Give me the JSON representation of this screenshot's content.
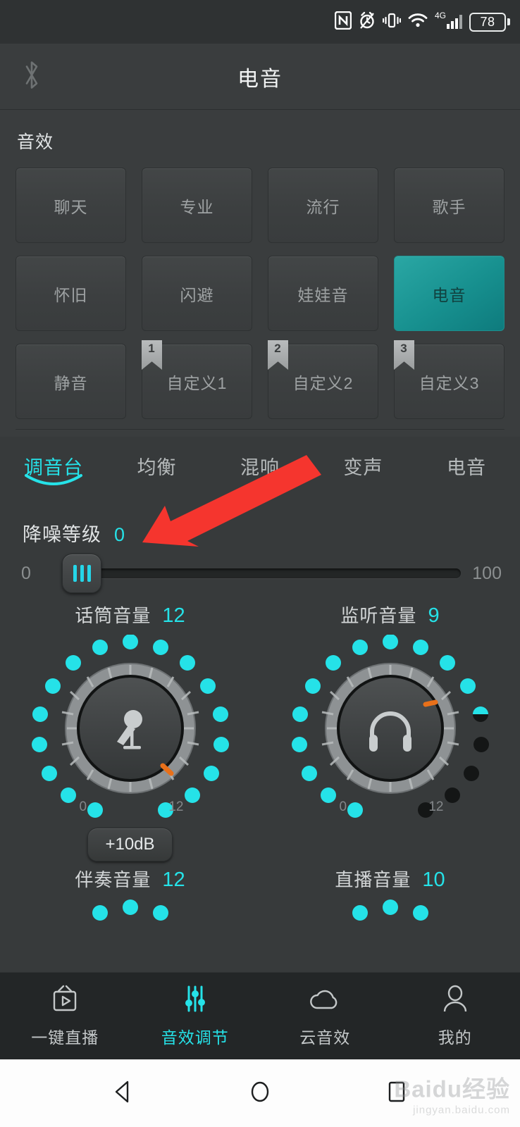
{
  "colors": {
    "accent_cyan": "#25e2e8",
    "selected_teal": "#17908f",
    "arrow_red": "#f5352e",
    "panel_bg": "#3a3d3e",
    "page_bg": "#373a3b",
    "nav_bg": "#232627",
    "indicator_orange": "#e8701a"
  },
  "status_bar": {
    "icons": [
      "nfc-icon",
      "alarm-icon",
      "vibrate-icon",
      "wifi-icon",
      "signal-4g-icon",
      "battery-icon"
    ],
    "network_label": "4G",
    "battery_level": "78"
  },
  "header": {
    "title": "电音",
    "left_icon": "bluetooth-icon"
  },
  "effects": {
    "section_title": "音效",
    "presets": [
      {
        "label": "聊天",
        "selected": false,
        "tag": ""
      },
      {
        "label": "专业",
        "selected": false,
        "tag": ""
      },
      {
        "label": "流行",
        "selected": false,
        "tag": ""
      },
      {
        "label": "歌手",
        "selected": false,
        "tag": ""
      },
      {
        "label": "怀旧",
        "selected": false,
        "tag": ""
      },
      {
        "label": "闪避",
        "selected": false,
        "tag": ""
      },
      {
        "label": "娃娃音",
        "selected": false,
        "tag": ""
      },
      {
        "label": "电音",
        "selected": true,
        "tag": ""
      },
      {
        "label": "静音",
        "selected": false,
        "tag": ""
      },
      {
        "label": "自定义1",
        "selected": false,
        "tag": "1"
      },
      {
        "label": "自定义2",
        "selected": false,
        "tag": "2"
      },
      {
        "label": "自定义3",
        "selected": false,
        "tag": "3"
      }
    ]
  },
  "tabs": [
    {
      "label": "调音台",
      "active": true
    },
    {
      "label": "均衡",
      "active": false
    },
    {
      "label": "混响",
      "active": false
    },
    {
      "label": "变声",
      "active": false
    },
    {
      "label": "电音",
      "active": false
    }
  ],
  "noise_reduction": {
    "label": "降噪等级",
    "value": "0",
    "min_label": "0",
    "max_label": "100",
    "thumb_position_percent": 0
  },
  "knobs": [
    {
      "label": "话筒音量",
      "value": "12",
      "icon": "microphone-icon",
      "min_label": "0",
      "max_label": "12",
      "leds_total": 17,
      "leds_lit": 17,
      "boost_button": "+10dB"
    },
    {
      "label": "监听音量",
      "value": "9",
      "icon": "headphone-icon",
      "min_label": "0",
      "max_label": "12",
      "leds_total": 17,
      "leds_lit": 13,
      "boost_button": ""
    }
  ],
  "knobs_lower": [
    {
      "label": "伴奏音量",
      "value": "12"
    },
    {
      "label": "直播音量",
      "value": "10"
    }
  ],
  "annotation": {
    "type": "arrow",
    "points_to": "降噪等级 value"
  },
  "bottom_nav": [
    {
      "label": "一键直播",
      "icon": "live-tv-icon",
      "active": false
    },
    {
      "label": "音效调节",
      "icon": "sliders-icon",
      "active": true
    },
    {
      "label": "云音效",
      "icon": "cloud-icon",
      "active": false
    },
    {
      "label": "我的",
      "icon": "person-icon",
      "active": false
    }
  ],
  "android_nav": {
    "back": "back-triangle-icon",
    "home": "home-circle-icon",
    "recents": "recents-square-icon"
  },
  "watermark": {
    "main": "Baidu经验",
    "sub": "jingyan.baidu.com"
  }
}
